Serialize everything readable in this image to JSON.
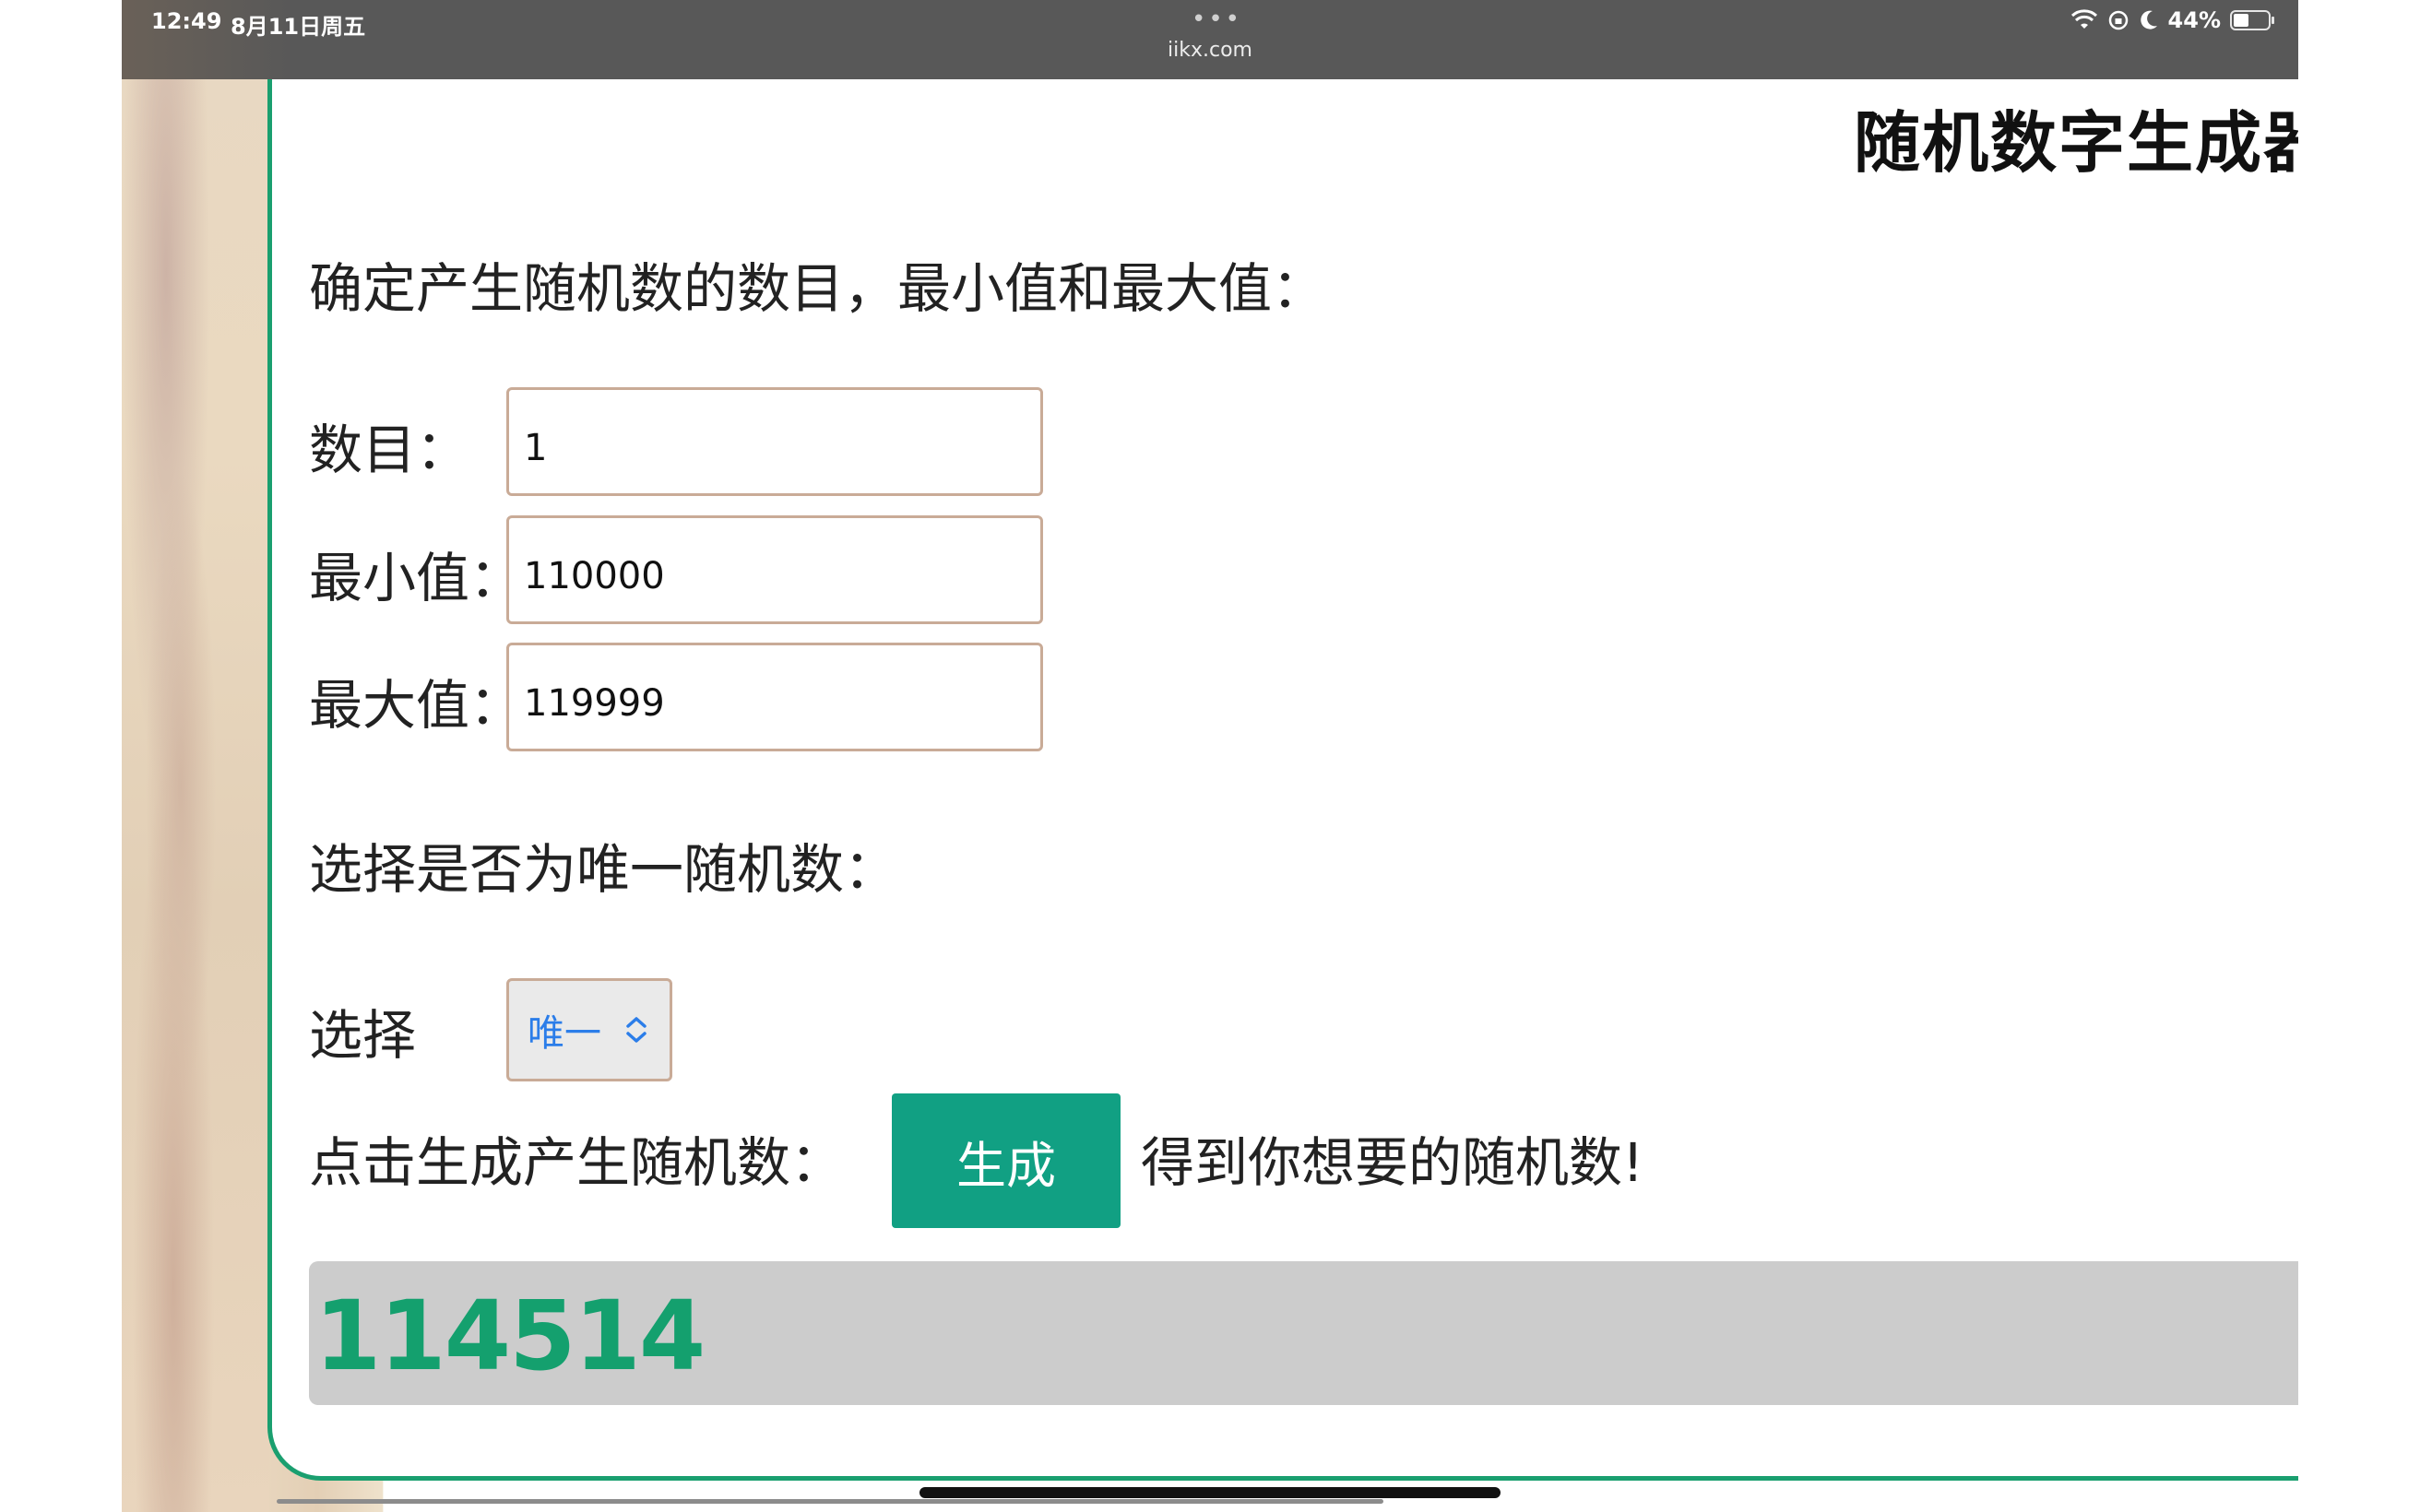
{
  "status_bar": {
    "time": "12:49",
    "date": "8月11日周五",
    "url": "iikx.com",
    "battery": "44%",
    "icons": [
      "wifi-icon",
      "rotation-lock-icon",
      "moon-icon",
      "battery-icon"
    ]
  },
  "page": {
    "title": "随机数字生成器",
    "intro": "确定产生随机数的数目，最小值和最大值：",
    "fields": {
      "count_label": "数目：",
      "count_value": "1",
      "min_label": "最小值：",
      "min_value": "110000",
      "max_label": "最大值：",
      "max_value": "119999"
    },
    "unique_question": "选择是否为唯一随机数：",
    "select_label": "选择",
    "select_value": "唯一",
    "click_label": "点击生成产生随机数：",
    "generate_button": "生成",
    "result_hint": "得到你想要的随机数!",
    "result_value": "114514"
  },
  "colors": {
    "accent_green": "#1a9f6f",
    "button_teal": "#11a083",
    "result_green": "#14a06e",
    "select_blue": "#2b7de9"
  }
}
